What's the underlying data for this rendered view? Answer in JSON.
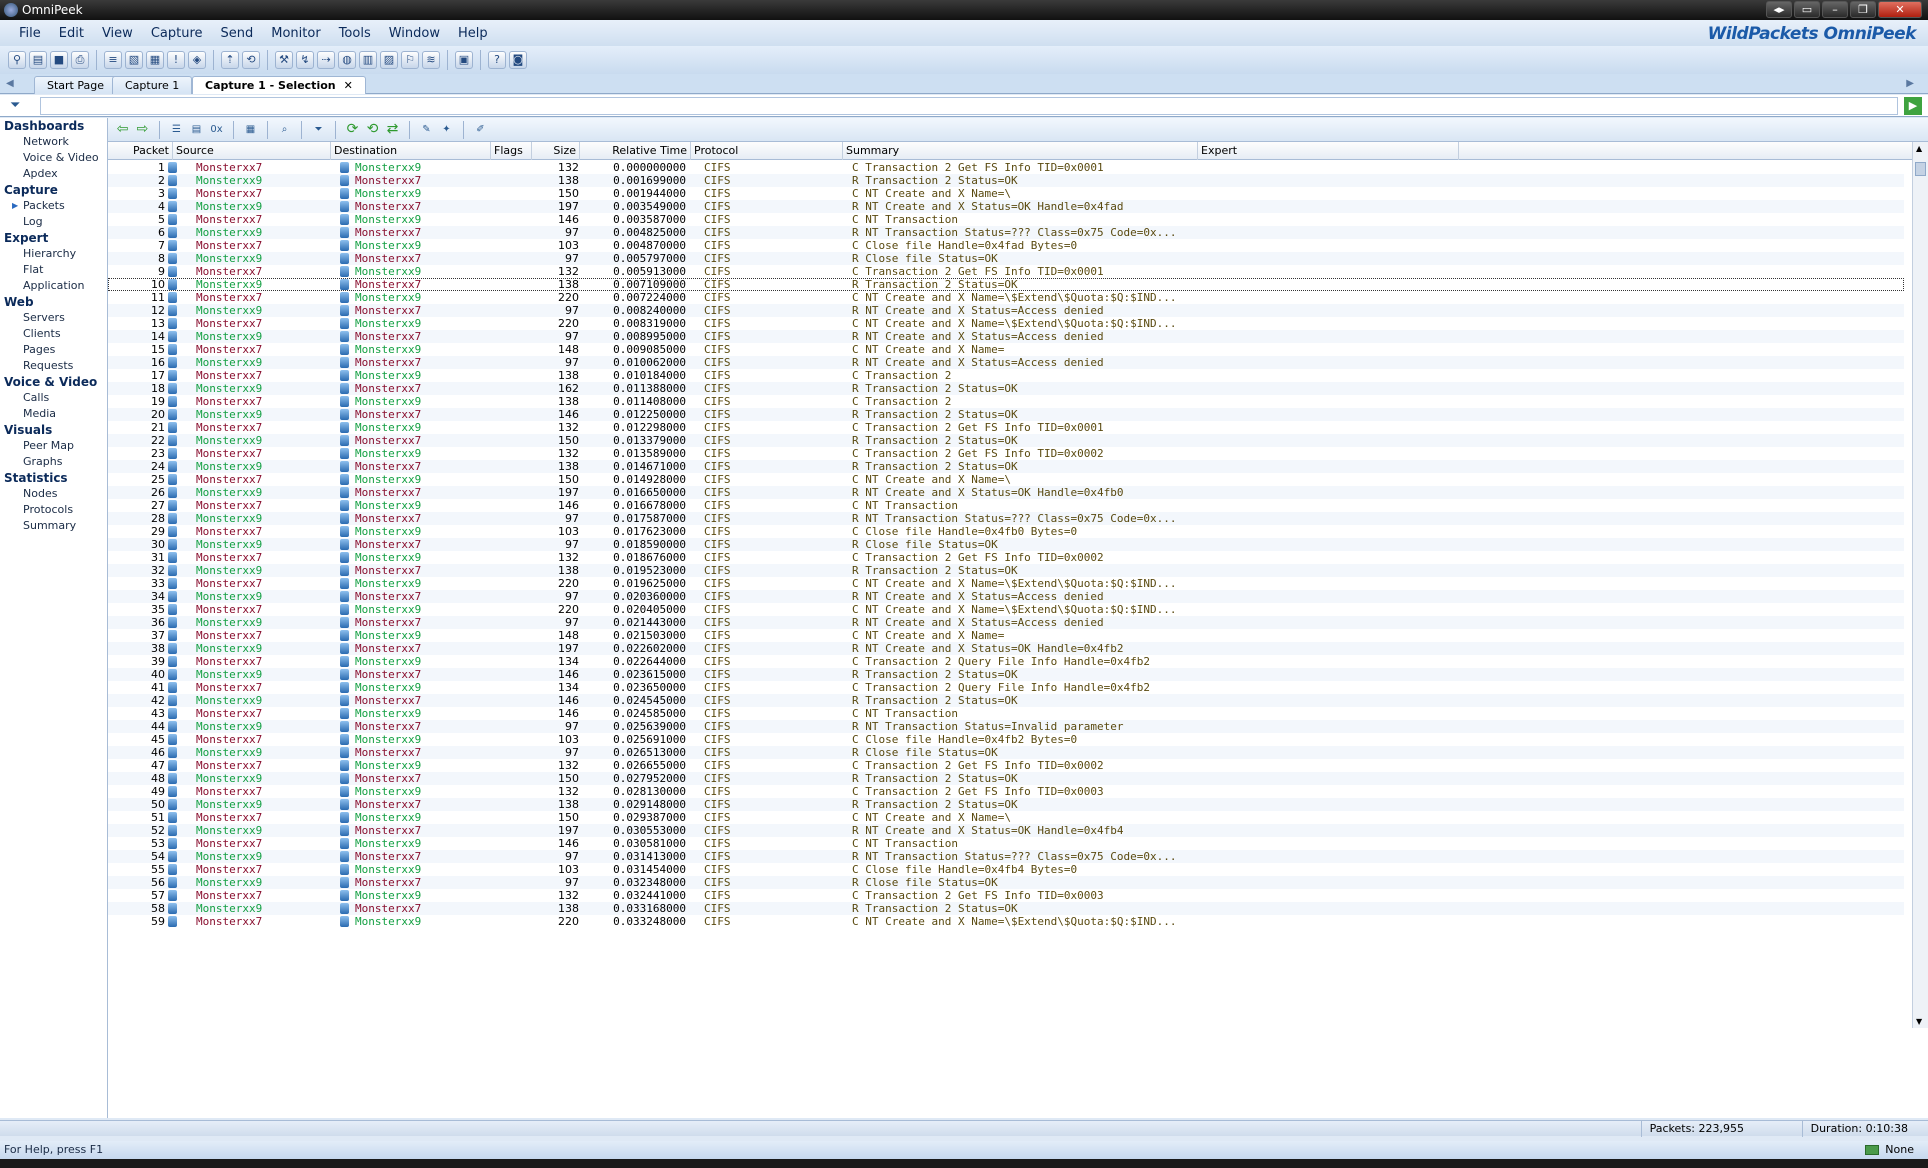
{
  "window": {
    "title": "OmniPeek",
    "buttons": [
      "◂▸",
      "▭",
      "–",
      "❐",
      "✕"
    ]
  },
  "menu": [
    "File",
    "Edit",
    "View",
    "Capture",
    "Send",
    "Monitor",
    "Tools",
    "Window",
    "Help"
  ],
  "brand": "WildPackets OmniPeek",
  "tabs": [
    {
      "label": "Start Page"
    },
    {
      "label": "Capture 1"
    },
    {
      "label": "Capture 1 - Selection",
      "close": "✕"
    }
  ],
  "filter": {
    "value": ""
  },
  "sidebar": [
    {
      "group": "Dashboards",
      "items": [
        "Network",
        "Voice & Video",
        "Apdex"
      ]
    },
    {
      "group": "Capture",
      "items": [
        "Packets",
        "Log"
      ]
    },
    {
      "group": "Expert",
      "items": [
        "Hierarchy",
        "Flat",
        "Application"
      ]
    },
    {
      "group": "Web",
      "items": [
        "Servers",
        "Clients",
        "Pages",
        "Requests"
      ]
    },
    {
      "group": "Voice & Video",
      "items": [
        "Calls",
        "Media"
      ]
    },
    {
      "group": "Visuals",
      "items": [
        "Peer Map",
        "Graphs"
      ]
    },
    {
      "group": "Statistics",
      "items": [
        "Nodes",
        "Protocols",
        "Summary"
      ]
    }
  ],
  "active_nav": "Packets",
  "columns": [
    "Packet",
    "Source",
    "Destination",
    "Flags",
    "Size",
    "Relative Time",
    "Protocol",
    "Summary",
    "Expert"
  ],
  "selected_packet": 10,
  "packets": [
    [
      "1",
      "Monsterxx7",
      "Monsterxx9",
      "132",
      "0.000000000",
      "CIFS",
      "C Transaction 2 Get FS Info TID=0x0001"
    ],
    [
      "2",
      "Monsterxx9",
      "Monsterxx7",
      "138",
      "0.001699000",
      "CIFS",
      "R Transaction 2 Status=OK"
    ],
    [
      "3",
      "Monsterxx7",
      "Monsterxx9",
      "150",
      "0.001944000",
      "CIFS",
      "C NT Create and X Name=\\"
    ],
    [
      "4",
      "Monsterxx9",
      "Monsterxx7",
      "197",
      "0.003549000",
      "CIFS",
      "R NT Create and X Status=OK Handle=0x4fad"
    ],
    [
      "5",
      "Monsterxx7",
      "Monsterxx9",
      "146",
      "0.003587000",
      "CIFS",
      "C NT Transaction"
    ],
    [
      "6",
      "Monsterxx9",
      "Monsterxx7",
      "97",
      "0.004825000",
      "CIFS",
      "R NT Transaction Status=??? Class=0x75 Code=0x..."
    ],
    [
      "7",
      "Monsterxx7",
      "Monsterxx9",
      "103",
      "0.004870000",
      "CIFS",
      "C Close file Handle=0x4fad Bytes=0"
    ],
    [
      "8",
      "Monsterxx9",
      "Monsterxx7",
      "97",
      "0.005797000",
      "CIFS",
      "R Close file Status=OK"
    ],
    [
      "9",
      "Monsterxx7",
      "Monsterxx9",
      "132",
      "0.005913000",
      "CIFS",
      "C Transaction 2 Get FS Info TID=0x0001"
    ],
    [
      "10",
      "Monsterxx9",
      "Monsterxx7",
      "138",
      "0.007109000",
      "CIFS",
      "R Transaction 2 Status=OK"
    ],
    [
      "11",
      "Monsterxx7",
      "Monsterxx9",
      "220",
      "0.007224000",
      "CIFS",
      "C NT Create and X Name=\\$Extend\\$Quota:$Q:$IND..."
    ],
    [
      "12",
      "Monsterxx9",
      "Monsterxx7",
      "97",
      "0.008240000",
      "CIFS",
      "R NT Create and X Status=Access denied"
    ],
    [
      "13",
      "Monsterxx7",
      "Monsterxx9",
      "220",
      "0.008319000",
      "CIFS",
      "C NT Create and X Name=\\$Extend\\$Quota:$Q:$IND..."
    ],
    [
      "14",
      "Monsterxx9",
      "Monsterxx7",
      "97",
      "0.008995000",
      "CIFS",
      "R NT Create and X Status=Access denied"
    ],
    [
      "15",
      "Monsterxx7",
      "Monsterxx9",
      "148",
      "0.009085000",
      "CIFS",
      "C NT Create and X Name="
    ],
    [
      "16",
      "Monsterxx9",
      "Monsterxx7",
      "97",
      "0.010062000",
      "CIFS",
      "R NT Create and X Status=Access denied"
    ],
    [
      "17",
      "Monsterxx7",
      "Monsterxx9",
      "138",
      "0.010184000",
      "CIFS",
      "C Transaction 2"
    ],
    [
      "18",
      "Monsterxx9",
      "Monsterxx7",
      "162",
      "0.011388000",
      "CIFS",
      "R Transaction 2 Status=OK"
    ],
    [
      "19",
      "Monsterxx7",
      "Monsterxx9",
      "138",
      "0.011408000",
      "CIFS",
      "C Transaction 2"
    ],
    [
      "20",
      "Monsterxx9",
      "Monsterxx7",
      "146",
      "0.012250000",
      "CIFS",
      "R Transaction 2 Status=OK"
    ],
    [
      "21",
      "Monsterxx7",
      "Monsterxx9",
      "132",
      "0.012298000",
      "CIFS",
      "C Transaction 2 Get FS Info TID=0x0001"
    ],
    [
      "22",
      "Monsterxx9",
      "Monsterxx7",
      "150",
      "0.013379000",
      "CIFS",
      "R Transaction 2 Status=OK"
    ],
    [
      "23",
      "Monsterxx7",
      "Monsterxx9",
      "132",
      "0.013589000",
      "CIFS",
      "C Transaction 2 Get FS Info TID=0x0002"
    ],
    [
      "24",
      "Monsterxx9",
      "Monsterxx7",
      "138",
      "0.014671000",
      "CIFS",
      "R Transaction 2 Status=OK"
    ],
    [
      "25",
      "Monsterxx7",
      "Monsterxx9",
      "150",
      "0.014928000",
      "CIFS",
      "C NT Create and X Name=\\"
    ],
    [
      "26",
      "Monsterxx9",
      "Monsterxx7",
      "197",
      "0.016650000",
      "CIFS",
      "R NT Create and X Status=OK Handle=0x4fb0"
    ],
    [
      "27",
      "Monsterxx7",
      "Monsterxx9",
      "146",
      "0.016678000",
      "CIFS",
      "C NT Transaction"
    ],
    [
      "28",
      "Monsterxx9",
      "Monsterxx7",
      "97",
      "0.017587000",
      "CIFS",
      "R NT Transaction Status=??? Class=0x75 Code=0x..."
    ],
    [
      "29",
      "Monsterxx7",
      "Monsterxx9",
      "103",
      "0.017623000",
      "CIFS",
      "C Close file Handle=0x4fb0 Bytes=0"
    ],
    [
      "30",
      "Monsterxx9",
      "Monsterxx7",
      "97",
      "0.018590000",
      "CIFS",
      "R Close file Status=OK"
    ],
    [
      "31",
      "Monsterxx7",
      "Monsterxx9",
      "132",
      "0.018676000",
      "CIFS",
      "C Transaction 2 Get FS Info TID=0x0002"
    ],
    [
      "32",
      "Monsterxx9",
      "Monsterxx7",
      "138",
      "0.019523000",
      "CIFS",
      "R Transaction 2 Status=OK"
    ],
    [
      "33",
      "Monsterxx7",
      "Monsterxx9",
      "220",
      "0.019625000",
      "CIFS",
      "C NT Create and X Name=\\$Extend\\$Quota:$Q:$IND..."
    ],
    [
      "34",
      "Monsterxx9",
      "Monsterxx7",
      "97",
      "0.020360000",
      "CIFS",
      "R NT Create and X Status=Access denied"
    ],
    [
      "35",
      "Monsterxx7",
      "Monsterxx9",
      "220",
      "0.020405000",
      "CIFS",
      "C NT Create and X Name=\\$Extend\\$Quota:$Q:$IND..."
    ],
    [
      "36",
      "Monsterxx9",
      "Monsterxx7",
      "97",
      "0.021443000",
      "CIFS",
      "R NT Create and X Status=Access denied"
    ],
    [
      "37",
      "Monsterxx7",
      "Monsterxx9",
      "148",
      "0.021503000",
      "CIFS",
      "C NT Create and X Name="
    ],
    [
      "38",
      "Monsterxx9",
      "Monsterxx7",
      "197",
      "0.022602000",
      "CIFS",
      "R NT Create and X Status=OK Handle=0x4fb2"
    ],
    [
      "39",
      "Monsterxx7",
      "Monsterxx9",
      "134",
      "0.022644000",
      "CIFS",
      "C Transaction 2 Query File Info Handle=0x4fb2"
    ],
    [
      "40",
      "Monsterxx9",
      "Monsterxx7",
      "146",
      "0.023615000",
      "CIFS",
      "R Transaction 2 Status=OK"
    ],
    [
      "41",
      "Monsterxx7",
      "Monsterxx9",
      "134",
      "0.023650000",
      "CIFS",
      "C Transaction 2 Query File Info Handle=0x4fb2"
    ],
    [
      "42",
      "Monsterxx9",
      "Monsterxx7",
      "146",
      "0.024545000",
      "CIFS",
      "R Transaction 2 Status=OK"
    ],
    [
      "43",
      "Monsterxx7",
      "Monsterxx9",
      "146",
      "0.024585000",
      "CIFS",
      "C NT Transaction"
    ],
    [
      "44",
      "Monsterxx9",
      "Monsterxx7",
      "97",
      "0.025639000",
      "CIFS",
      "R NT Transaction Status=Invalid parameter"
    ],
    [
      "45",
      "Monsterxx7",
      "Monsterxx9",
      "103",
      "0.025691000",
      "CIFS",
      "C Close file Handle=0x4fb2 Bytes=0"
    ],
    [
      "46",
      "Monsterxx9",
      "Monsterxx7",
      "97",
      "0.026513000",
      "CIFS",
      "R Close file Status=OK"
    ],
    [
      "47",
      "Monsterxx7",
      "Monsterxx9",
      "132",
      "0.026655000",
      "CIFS",
      "C Transaction 2 Get FS Info TID=0x0002"
    ],
    [
      "48",
      "Monsterxx9",
      "Monsterxx7",
      "150",
      "0.027952000",
      "CIFS",
      "R Transaction 2 Status=OK"
    ],
    [
      "49",
      "Monsterxx7",
      "Monsterxx9",
      "132",
      "0.028130000",
      "CIFS",
      "C Transaction 2 Get FS Info TID=0x0003"
    ],
    [
      "50",
      "Monsterxx9",
      "Monsterxx7",
      "138",
      "0.029148000",
      "CIFS",
      "R Transaction 2 Status=OK"
    ],
    [
      "51",
      "Monsterxx7",
      "Monsterxx9",
      "150",
      "0.029387000",
      "CIFS",
      "C NT Create and X Name=\\"
    ],
    [
      "52",
      "Monsterxx9",
      "Monsterxx7",
      "197",
      "0.030553000",
      "CIFS",
      "R NT Create and X Status=OK Handle=0x4fb4"
    ],
    [
      "53",
      "Monsterxx7",
      "Monsterxx9",
      "146",
      "0.030581000",
      "CIFS",
      "C NT Transaction"
    ],
    [
      "54",
      "Monsterxx9",
      "Monsterxx7",
      "97",
      "0.031413000",
      "CIFS",
      "R NT Transaction Status=??? Class=0x75 Code=0x..."
    ],
    [
      "55",
      "Monsterxx7",
      "Monsterxx9",
      "103",
      "0.031454000",
      "CIFS",
      "C Close file Handle=0x4fb4 Bytes=0"
    ],
    [
      "56",
      "Monsterxx9",
      "Monsterxx7",
      "97",
      "0.032348000",
      "CIFS",
      "R Close file Status=OK"
    ],
    [
      "57",
      "Monsterxx7",
      "Monsterxx9",
      "132",
      "0.032441000",
      "CIFS",
      "C Transaction 2 Get FS Info TID=0x0003"
    ],
    [
      "58",
      "Monsterxx9",
      "Monsterxx7",
      "138",
      "0.033168000",
      "CIFS",
      "R Transaction 2 Status=OK"
    ],
    [
      "59",
      "Monsterxx7",
      "Monsterxx9",
      "220",
      "0.033248000",
      "CIFS",
      "C NT Create and X Name=\\$Extend\\$Quota:$Q:$IND..."
    ]
  ],
  "status": {
    "packets_label": "Packets: 223,955",
    "duration_label": "Duration: 0:10:38",
    "help": "For Help, press F1",
    "adapter": "None"
  },
  "colors": {
    "node7": "#8a1030",
    "node9": "#14a043",
    "summary": "#5a4a10"
  }
}
